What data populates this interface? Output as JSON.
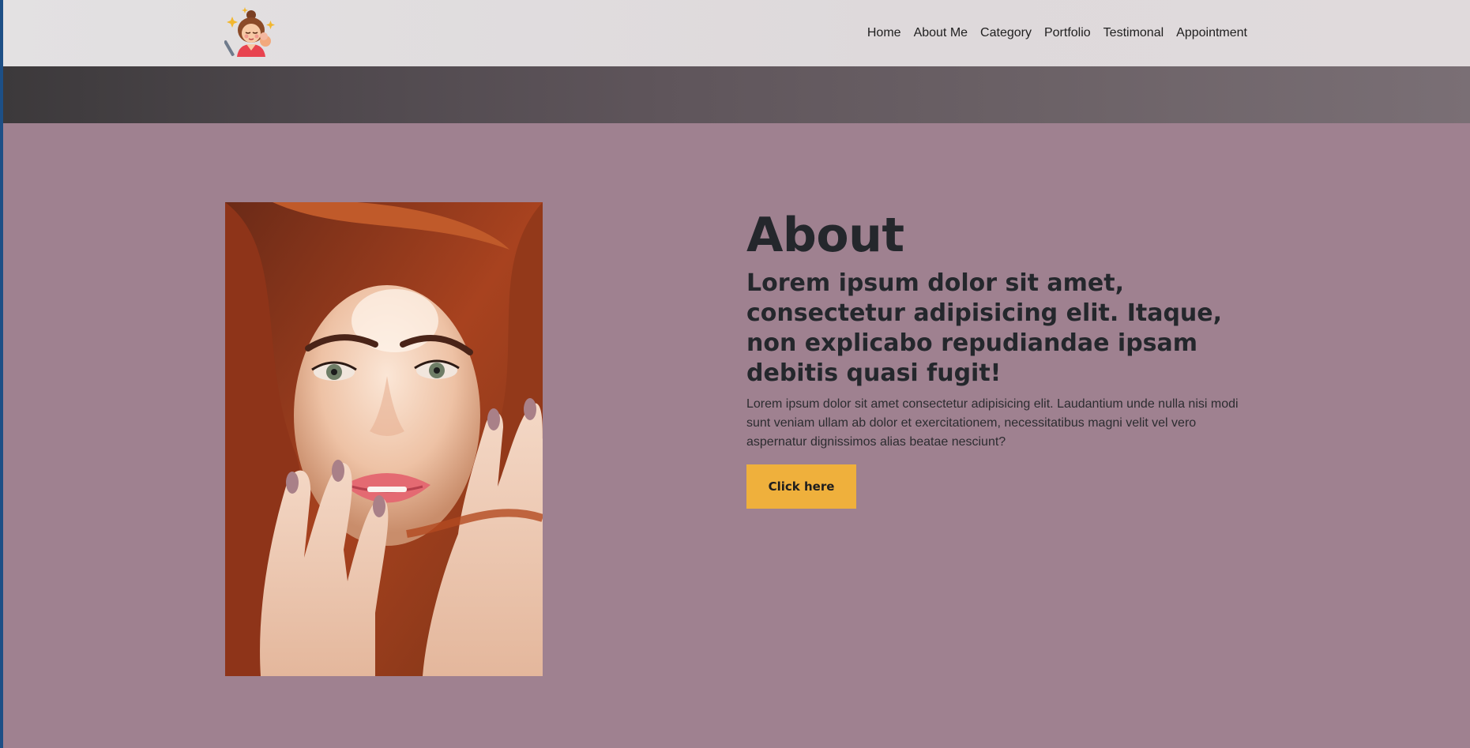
{
  "nav": {
    "logo_icon": "makeup-artist-logo-icon",
    "items": [
      {
        "label": "Home"
      },
      {
        "label": "About Me"
      },
      {
        "label": "Category"
      },
      {
        "label": "Portfolio"
      },
      {
        "label": "Testimonal"
      },
      {
        "label": "Appointment"
      }
    ]
  },
  "about": {
    "title": "About",
    "subtitle": "Lorem ipsum dolor sit amet, consectetur adipisicing elit. Itaque, non explicabo repudiandae ipsam debitis quasi fugit!",
    "body": "Lorem ipsum dolor sit amet consectetur adipisicing elit. Laudantium unde nulla nisi modi sunt veniam ullam ab dolor et exercitationem, necessitatibus magni velit vel vero aspernatur dignissimos alias beatae nesciunt?",
    "button_label": "Click here",
    "image_icon": "portrait-photo"
  },
  "colors": {
    "section_bg": "#9f8190",
    "button_bg": "#efb03c",
    "heading": "#24272c"
  }
}
